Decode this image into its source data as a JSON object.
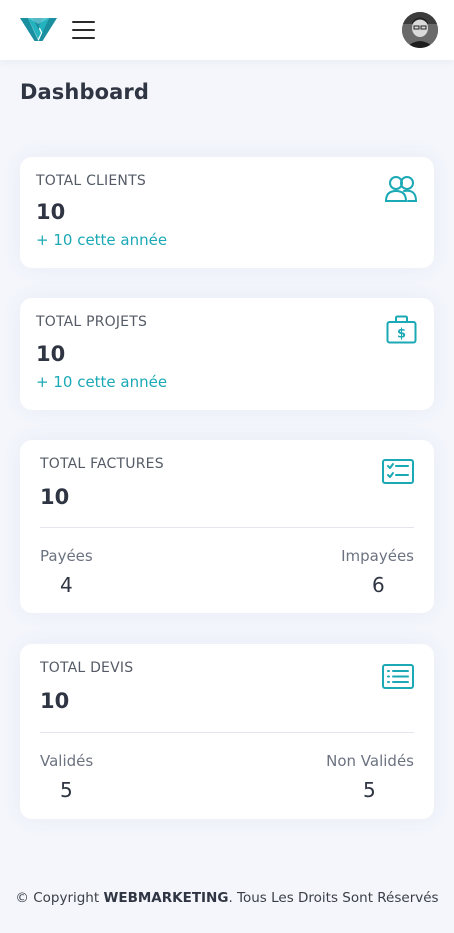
{
  "header": {
    "logo_icon": "w-logo-icon",
    "menu_icon": "hamburger-menu-icon",
    "avatar": "user-avatar"
  },
  "page": {
    "title": "Dashboard"
  },
  "colors": {
    "accent": "#1aa9b5",
    "text": "#2f3542",
    "background": "#f4f6fc"
  },
  "cards": {
    "clients": {
      "label": "TOTAL CLIENTS",
      "value": "10",
      "sub": "+ 10 cette année",
      "icon": "users-icon"
    },
    "projets": {
      "label": "TOTAL PROJETS",
      "value": "10",
      "sub": "+ 10 cette année",
      "icon": "briefcase-dollar-icon"
    },
    "factures": {
      "label": "TOTAL FACTURES",
      "value": "10",
      "icon": "checklist-icon",
      "left_label": "Payées",
      "left_value": "4",
      "right_label": "Impayées",
      "right_value": "6"
    },
    "devis": {
      "label": "TOTAL DEVIS",
      "value": "10",
      "icon": "list-icon",
      "left_label": "Validés",
      "left_value": "5",
      "right_label": "Non Validés",
      "right_value": "5"
    }
  },
  "footer": {
    "prefix": "© Copyright ",
    "brand": "WEBMARKETING",
    "suffix": ". Tous Les Droits Sont Réservés"
  }
}
